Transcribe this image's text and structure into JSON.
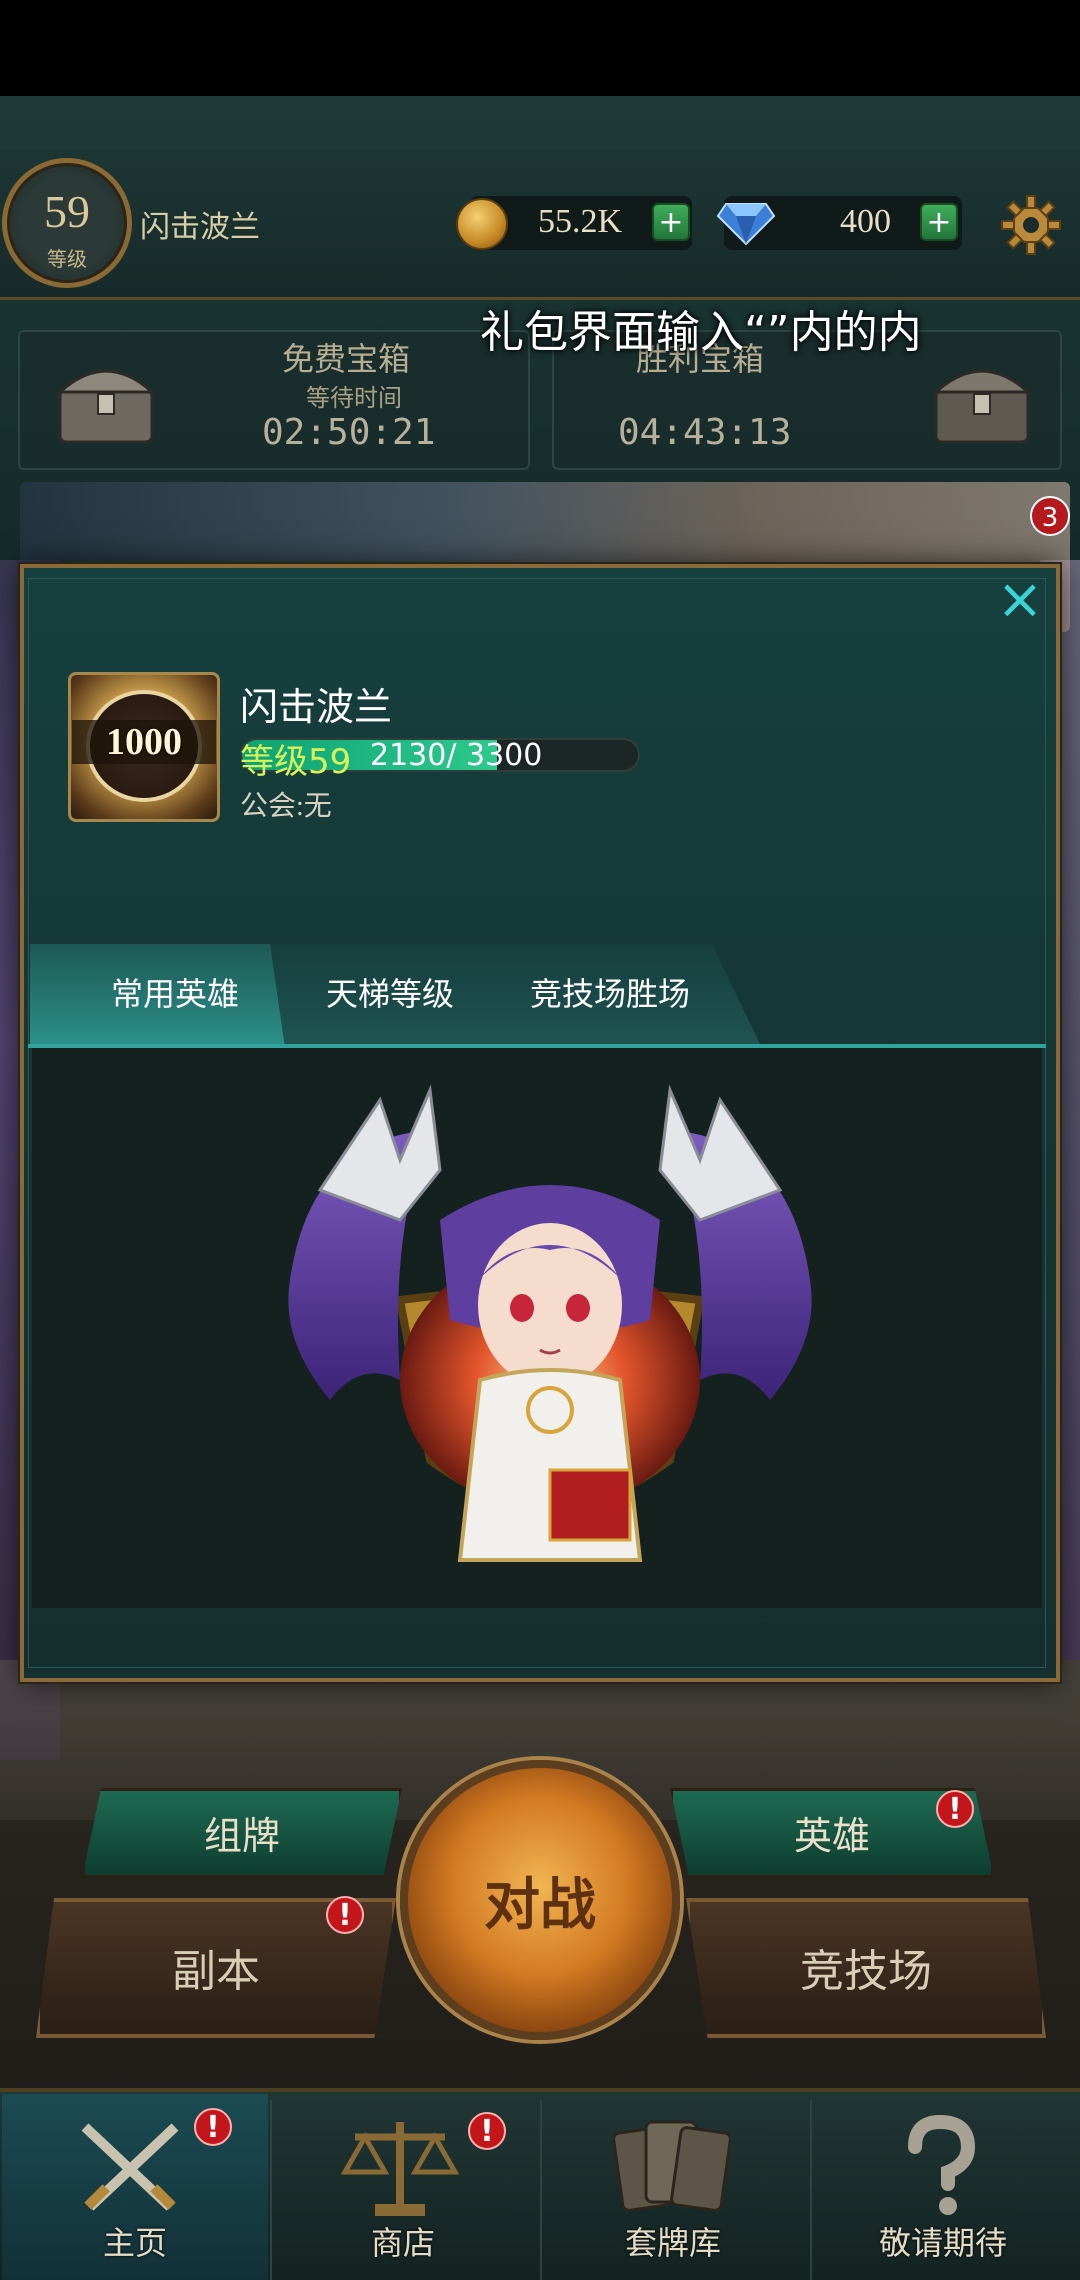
{
  "header": {
    "level": "59",
    "level_label": "等级",
    "player_name": "闪击波兰",
    "gold": "55.2K",
    "gems": "400",
    "plus": "+"
  },
  "hint_text": "礼包界面输入“”内的内",
  "chests": {
    "free": {
      "title": "免费宝箱",
      "subtitle": "等待时间",
      "timer": "02:50:21"
    },
    "win": {
      "title": "胜利宝箱",
      "timer": "04:43:13"
    }
  },
  "event_badge": "3",
  "modal": {
    "close": "×",
    "rank_value": "1000",
    "name": "闪击波兰",
    "level_text": "等级59",
    "exp_text": "2130/ 3300",
    "exp_progress": 0.645,
    "guild": "公会:无",
    "tabs": [
      {
        "label": "常用英雄",
        "active": true
      },
      {
        "label": "天梯等级",
        "active": false
      },
      {
        "label": "竞技场胜场",
        "active": false
      }
    ]
  },
  "main_buttons": {
    "deck": "组牌",
    "hero": "英雄",
    "battle": "对战",
    "dungeon": "副本",
    "arena": "竞技场",
    "alert": "!"
  },
  "bottom_nav": [
    {
      "label": "主页",
      "icon": "crossed-swords-icon"
    },
    {
      "label": "商店",
      "icon": "scales-icon"
    },
    {
      "label": "套牌库",
      "icon": "cards-icon"
    },
    {
      "label": "敬请期待",
      "icon": "question-icon"
    }
  ],
  "colors": {
    "accent_teal": "#2fa39c",
    "exp_green": "#2ec98e",
    "level_text": "#d8f25a",
    "alert_red": "#c3161b",
    "frame_gold": "#8a6a3a"
  }
}
